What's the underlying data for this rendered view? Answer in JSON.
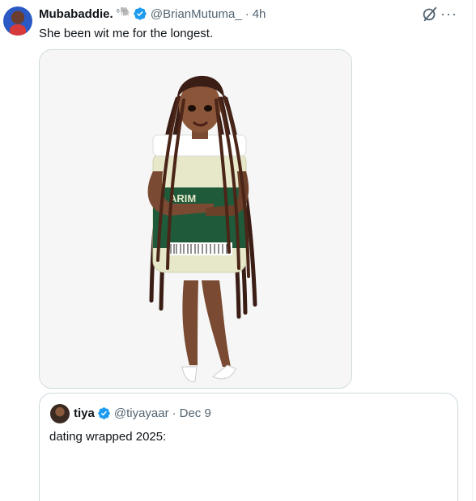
{
  "tweet": {
    "author": {
      "display_name": "Mubabaddie.",
      "name_suffix": "⁶🐘",
      "handle": "@BrianMutuma_",
      "time": "4h",
      "verified": true
    },
    "text": "She been wit me for the longest.",
    "media": {
      "label_text": "ARIM"
    },
    "actions": {
      "grok_icon": "grok-icon",
      "more_icon": "more-icon",
      "more_glyph": "···"
    }
  },
  "quote": {
    "author": {
      "display_name": "tiya",
      "handle": "@tiyayaar",
      "date": "Dec 9",
      "verified": true
    },
    "text": "dating wrapped 2025:"
  },
  "separator": "·",
  "colors": {
    "verified_blue": "#1d9bf0",
    "secondary_text": "#536471",
    "border": "#cfd9de"
  }
}
